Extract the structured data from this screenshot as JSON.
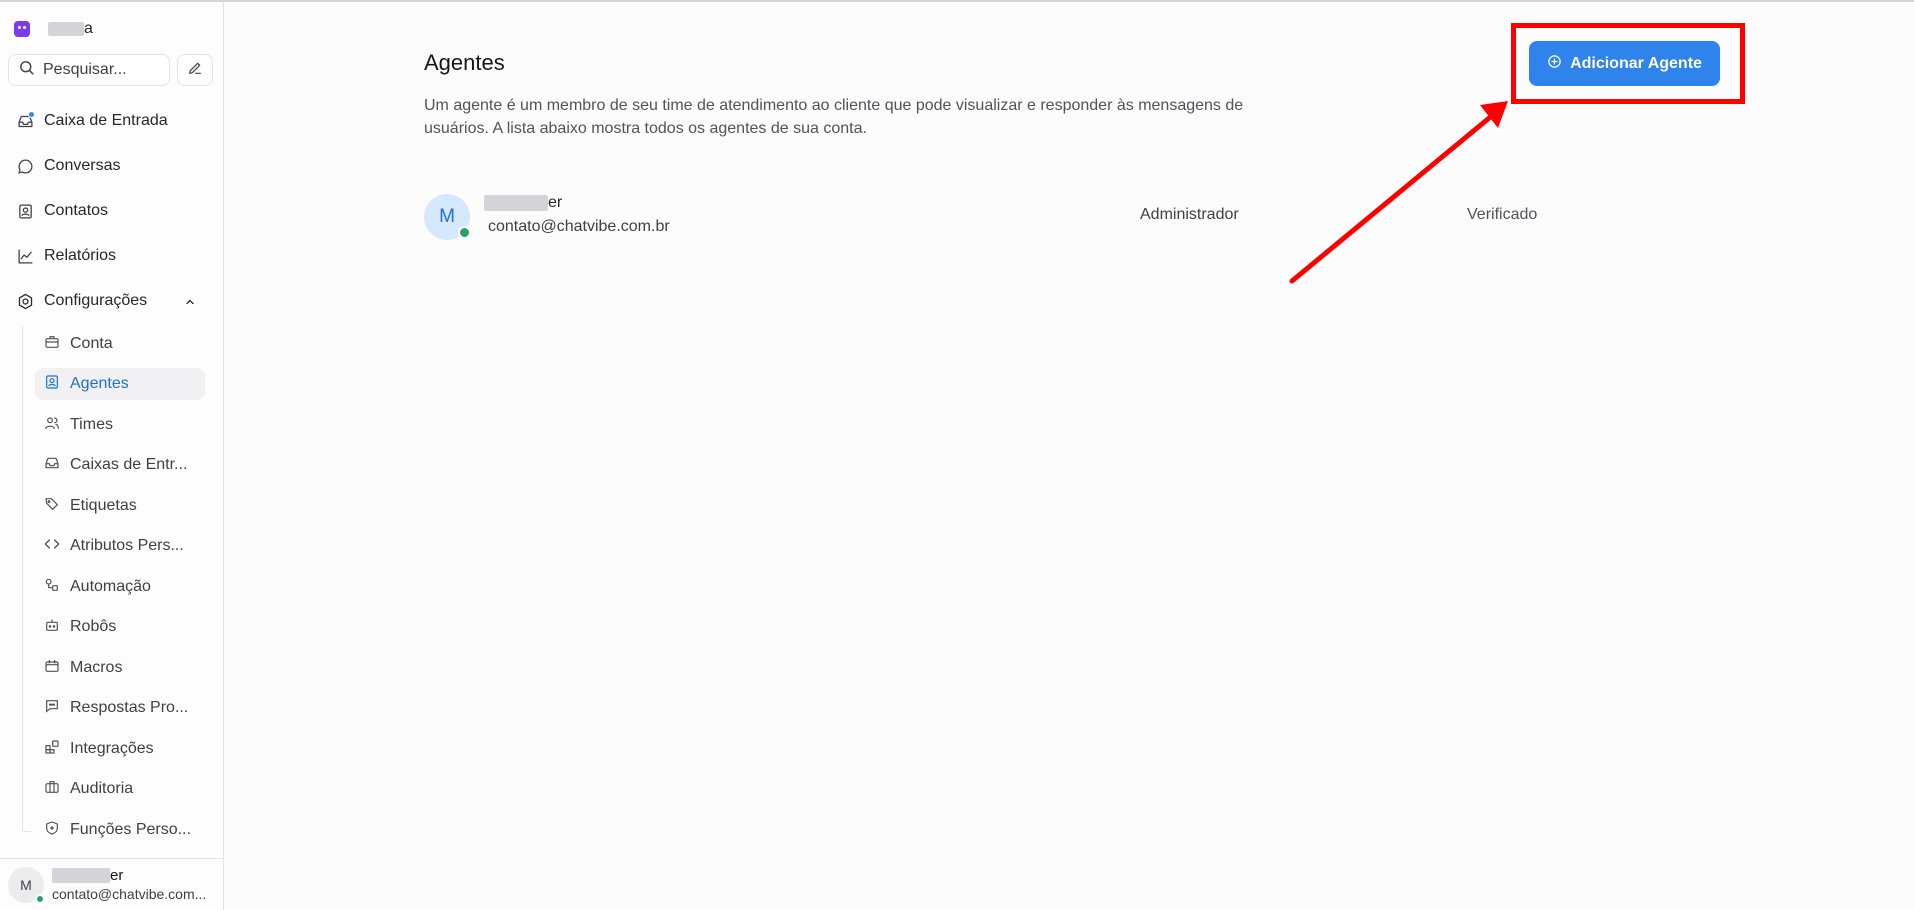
{
  "brand": {
    "name_suffix": "a",
    "logo_icon": "chatbot-logo-icon"
  },
  "search": {
    "placeholder": "Pesquisar..."
  },
  "nav": {
    "items": [
      {
        "label": "Caixa de Entrada",
        "icon": "inbox-icon"
      },
      {
        "label": "Conversas",
        "icon": "chat-bubble-icon"
      },
      {
        "label": "Contatos",
        "icon": "contact-card-icon"
      },
      {
        "label": "Relatórios",
        "icon": "line-chart-icon"
      },
      {
        "label": "Configurações",
        "icon": "settings-icon",
        "expanded": true
      }
    ],
    "settings_items": [
      {
        "label": "Conta",
        "icon": "briefcase-icon"
      },
      {
        "label": "Agentes",
        "icon": "agent-badge-icon",
        "active": true
      },
      {
        "label": "Times",
        "icon": "team-icon"
      },
      {
        "label": "Caixas de Entr...",
        "icon": "inbox-icon"
      },
      {
        "label": "Etiquetas",
        "icon": "tags-icon"
      },
      {
        "label": "Atributos Pers...",
        "icon": "code-icon"
      },
      {
        "label": "Automação",
        "icon": "automation-icon"
      },
      {
        "label": "Robôs",
        "icon": "bot-icon"
      },
      {
        "label": "Macros",
        "icon": "macro-icon"
      },
      {
        "label": "Respostas Pro...",
        "icon": "canned-response-icon"
      },
      {
        "label": "Integrações",
        "icon": "integrations-icon"
      },
      {
        "label": "Auditoria",
        "icon": "audit-briefcase-icon"
      },
      {
        "label": "Funções Perso...",
        "icon": "shield-icon"
      }
    ]
  },
  "current_user": {
    "initial": "M",
    "name_suffix": "er",
    "email": "contato@chatvibe.com..."
  },
  "page": {
    "title": "Agentes",
    "description": "Um agente é um membro de seu time de atendimento ao cliente que pode visualizar e responder às mensagens de usuários. A lista abaixo mostra todos os agentes de sua conta.",
    "add_button_label": "Adicionar Agente"
  },
  "agents": [
    {
      "initial": "M",
      "name_suffix": "er",
      "email": "contato@chatvibe.com.br",
      "role": "Administrador",
      "status": "Verificado"
    }
  ],
  "annotation": {
    "highlight_color": "#ff0000"
  },
  "colors": {
    "accent": "#2e84ea",
    "active_nav_text": "#1f6fd6",
    "online": "#22a36a"
  }
}
